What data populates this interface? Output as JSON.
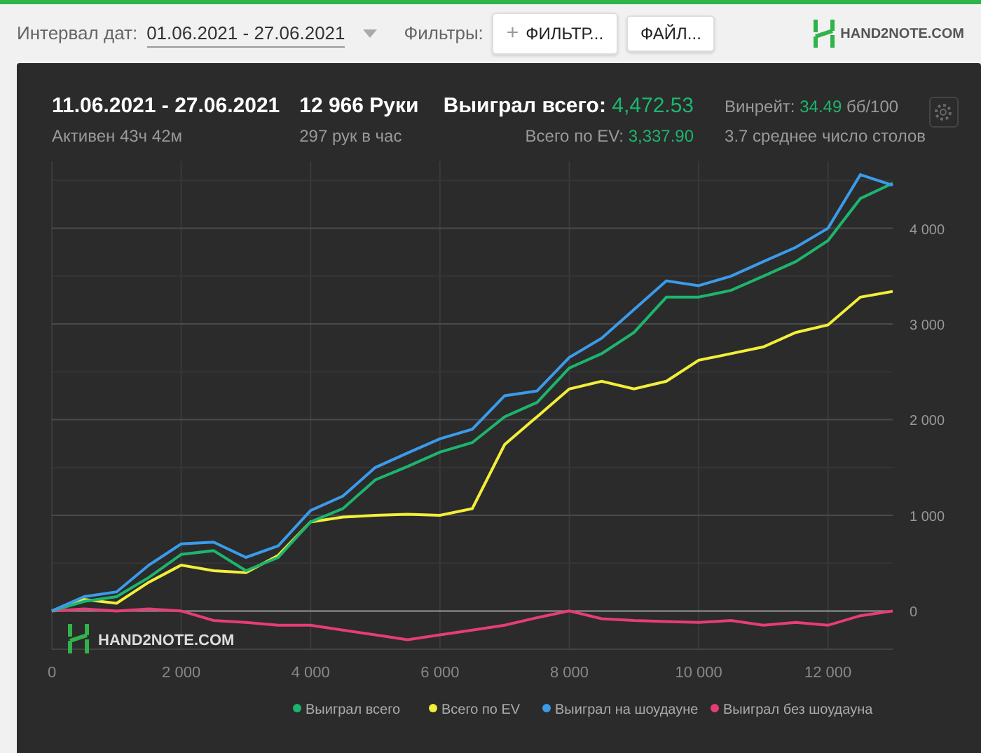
{
  "toolbar": {
    "date_label": "Интервал дат:",
    "date_range": "01.06.2021 - 27.06.2021",
    "filters_label": "Фильтры:",
    "filter_icon": "+",
    "filter_button": "ФИЛЬТР...",
    "file_button": "ФАЙЛ...",
    "logo_text": "HAND2NOTE.COM"
  },
  "summary": [
    {
      "main": "11.06.2021 - 27.06.2021",
      "sub": "Активен 43ч 42м"
    },
    {
      "main": "12 966 Руки",
      "sub": "297 рук в час"
    },
    {
      "main_label": "Выиграл всего:",
      "main_value": "4,472.53",
      "sub_label": "Всего по EV:",
      "sub_value": "3,337.90"
    },
    {
      "label": "Винрейт:",
      "value": "34.49",
      "unit": "бб/100",
      "sub": "3.7 среднее число столов"
    }
  ],
  "chart_watermark": "HAND2NOTE.COM",
  "chart_data": {
    "type": "line",
    "x": [
      0,
      500,
      1000,
      1500,
      2000,
      2500,
      3000,
      3500,
      4000,
      4500,
      5000,
      5500,
      6000,
      6500,
      7000,
      7500,
      8000,
      8500,
      9000,
      9500,
      10000,
      10500,
      11000,
      11500,
      12000,
      12500,
      13000
    ],
    "xlim": [
      0,
      13000
    ],
    "ylim": [
      -400,
      4700
    ],
    "grid": true,
    "legend": "bottom",
    "xticks": [
      {
        "value": 0,
        "label": "0"
      },
      {
        "value": 2000,
        "label": "2 000"
      },
      {
        "value": 4000,
        "label": "4 000"
      },
      {
        "value": 6000,
        "label": "6 000"
      },
      {
        "value": 8000,
        "label": "8 000"
      },
      {
        "value": 10000,
        "label": "10 000"
      },
      {
        "value": 12000,
        "label": "12 000"
      }
    ],
    "yticks": [
      {
        "value": 0,
        "label": "0"
      },
      {
        "value": 1000,
        "label": "1 000"
      },
      {
        "value": 2000,
        "label": "2 000"
      },
      {
        "value": 3000,
        "label": "3 000"
      },
      {
        "value": 4000,
        "label": "4 000"
      }
    ],
    "series": [
      {
        "name": "Выиграл всего",
        "color": "#1db56e",
        "values": [
          0,
          100,
          150,
          350,
          590,
          630,
          420,
          560,
          930,
          1070,
          1370,
          1510,
          1660,
          1760,
          2030,
          2180,
          2540,
          2690,
          2910,
          3280,
          3280,
          3350,
          3500,
          3650,
          3870,
          4310,
          4470
        ]
      },
      {
        "name": "Всего по EV",
        "color": "#f2ee3a",
        "values": [
          0,
          120,
          80,
          300,
          480,
          420,
          400,
          580,
          930,
          980,
          1000,
          1010,
          1000,
          1070,
          1740,
          2030,
          2320,
          2400,
          2320,
          2400,
          2620,
          2690,
          2760,
          2910,
          2990,
          3280,
          3340
        ]
      },
      {
        "name": "Выиграл на шоудауне",
        "color": "#3b9bea",
        "values": [
          0,
          150,
          200,
          480,
          700,
          720,
          560,
          680,
          1050,
          1200,
          1500,
          1650,
          1800,
          1900,
          2250,
          2300,
          2650,
          2850,
          3150,
          3450,
          3400,
          3500,
          3650,
          3800,
          4000,
          4560,
          4450
        ]
      },
      {
        "name": "Выиграл без шоудауна",
        "color": "#e63d74",
        "values": [
          0,
          20,
          0,
          20,
          0,
          -100,
          -120,
          -150,
          -150,
          -200,
          -250,
          -300,
          -250,
          -200,
          -150,
          -70,
          0,
          -80,
          -100,
          -110,
          -120,
          -100,
          -150,
          -120,
          -150,
          -50,
          0
        ]
      }
    ]
  }
}
